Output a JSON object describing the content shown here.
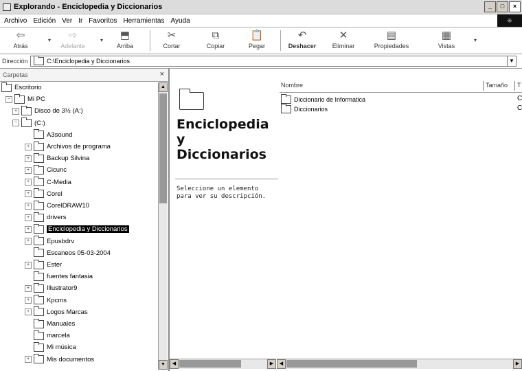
{
  "window": {
    "title": "Explorando - Enciclopedia y Diccionarios",
    "controls": [
      "_",
      "□",
      "×"
    ]
  },
  "menu": {
    "items": [
      "Archivo",
      "Edición",
      "Ver",
      "Ir",
      "Favoritos",
      "Herramientas",
      "Ayuda"
    ]
  },
  "toolbar": {
    "back": "Atrás",
    "forward": "Adelante",
    "up": "Arriba",
    "cut": "Cortar",
    "copy": "Copiar",
    "paste": "Pegar",
    "undo": "Deshacer",
    "delete": "Eliminar",
    "properties": "Propiedades",
    "views": "Vistas"
  },
  "address": {
    "label": "Dirección",
    "value": "C:\\Enciclopedia y Diccionarios"
  },
  "folders_pane": {
    "title": "Carpetas",
    "close": "×",
    "tree": [
      {
        "label": "Escritorio",
        "indent": 0,
        "expander": "",
        "icon": "desktop-icon"
      },
      {
        "label": "Mi PC",
        "indent": 1,
        "expander": "−",
        "icon": "computer-icon"
      },
      {
        "label": "Disco de 3½ (A:)",
        "indent": 2,
        "expander": "+",
        "icon": "floppy-icon"
      },
      {
        "label": "(C:)",
        "indent": 2,
        "expander": "−",
        "icon": "drive-icon"
      },
      {
        "label": "A3sound",
        "indent": 3,
        "expander": "",
        "icon": "folder-icon"
      },
      {
        "label": "Archivos de programa",
        "indent": 3,
        "expander": "+",
        "icon": "folder-icon"
      },
      {
        "label": "Backup Silvina",
        "indent": 3,
        "expander": "+",
        "icon": "folder-icon"
      },
      {
        "label": "Cicunc",
        "indent": 3,
        "expander": "+",
        "icon": "folder-icon"
      },
      {
        "label": "C-Media",
        "indent": 3,
        "expander": "+",
        "icon": "folder-icon"
      },
      {
        "label": "Corel",
        "indent": 3,
        "expander": "+",
        "icon": "folder-icon"
      },
      {
        "label": "CorelDRAW10",
        "indent": 3,
        "expander": "+",
        "icon": "folder-icon"
      },
      {
        "label": "drivers",
        "indent": 3,
        "expander": "+",
        "icon": "folder-icon"
      },
      {
        "label": "Enciclopedia y Diccionarios",
        "indent": 3,
        "expander": "+",
        "icon": "folder-open-icon",
        "selected": true
      },
      {
        "label": "Epusbdrv",
        "indent": 3,
        "expander": "+",
        "icon": "folder-icon"
      },
      {
        "label": "Escaneos 05-03-2004",
        "indent": 3,
        "expander": "",
        "icon": "folder-icon"
      },
      {
        "label": "Ester",
        "indent": 3,
        "expander": "+",
        "icon": "folder-icon"
      },
      {
        "label": "fuentes fantasia",
        "indent": 3,
        "expander": "",
        "icon": "folder-icon"
      },
      {
        "label": "Illustrator9",
        "indent": 3,
        "expander": "+",
        "icon": "folder-icon"
      },
      {
        "label": "Kpcms",
        "indent": 3,
        "expander": "+",
        "icon": "folder-icon"
      },
      {
        "label": "Logos Marcas",
        "indent": 3,
        "expander": "+",
        "icon": "folder-icon"
      },
      {
        "label": "Manuales",
        "indent": 3,
        "expander": "",
        "icon": "folder-icon"
      },
      {
        "label": "marcela",
        "indent": 3,
        "expander": "",
        "icon": "folder-icon"
      },
      {
        "label": "Mi música",
        "indent": 3,
        "expander": "",
        "icon": "folder-icon"
      },
      {
        "label": "Mis documentos",
        "indent": 3,
        "expander": "+",
        "icon": "documents-icon"
      }
    ]
  },
  "content": {
    "folder_title": "Enciclopedia y Diccionarios",
    "title_lines": [
      "Enciclopedia",
      "y",
      "Diccionarios"
    ],
    "description": "Seleccione un elemento para ver su descripción.",
    "columns": {
      "name": "Nombre",
      "size": "Tamaño",
      "type": "T"
    },
    "files": [
      {
        "name": "Diccionario de Informatica",
        "type": "C"
      },
      {
        "name": "Diccionarios",
        "type": "C"
      }
    ]
  }
}
